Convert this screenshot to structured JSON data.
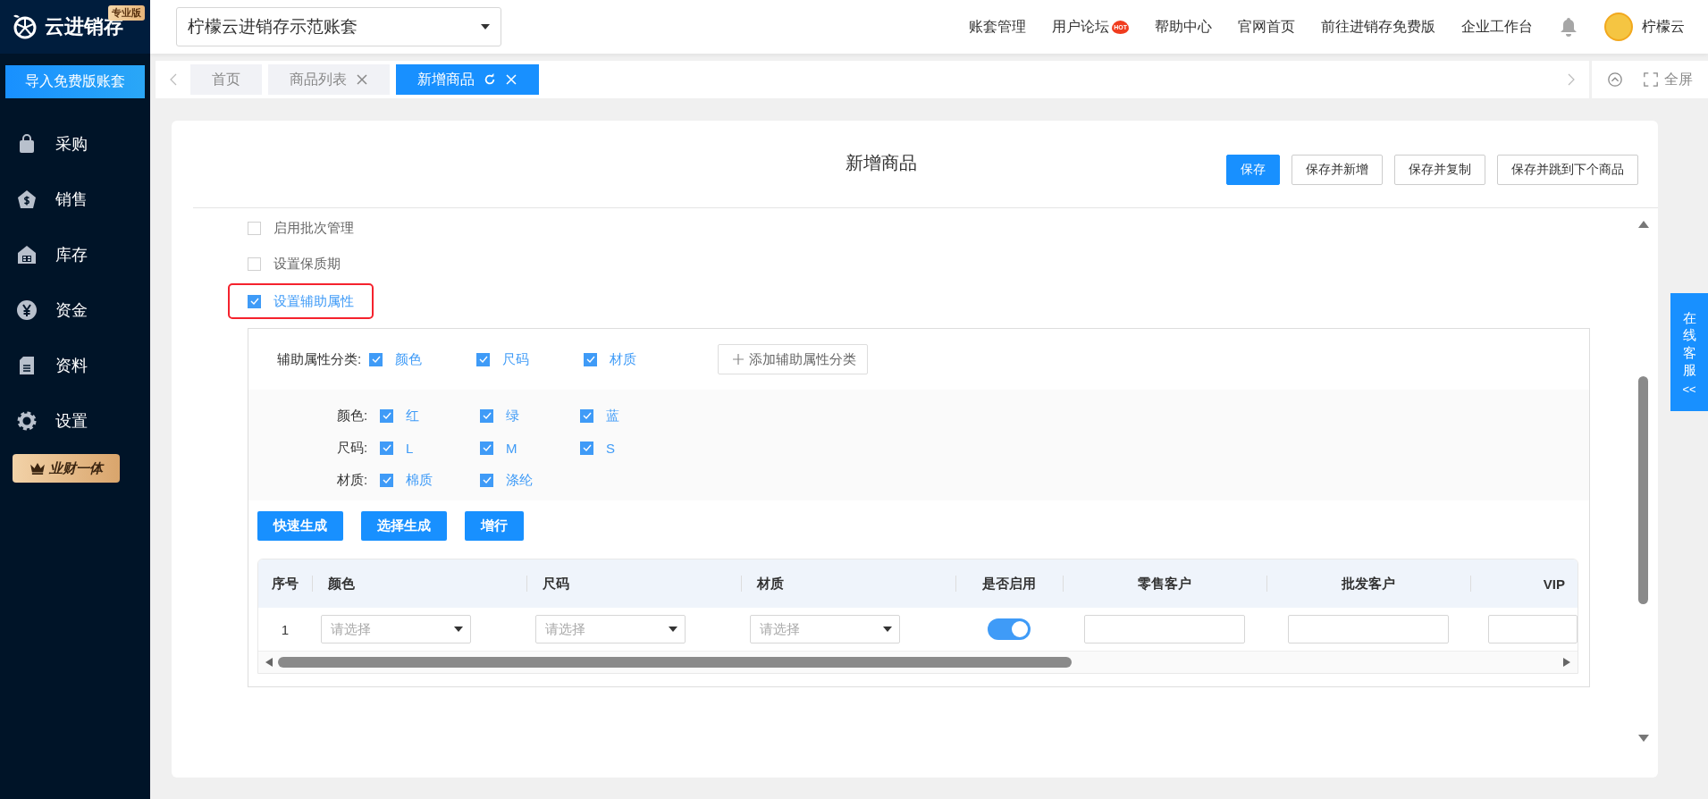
{
  "sidebar": {
    "logo": "云进销存",
    "edition_badge": "专业版",
    "import_button": "导入免费版账套",
    "items": [
      {
        "label": "采购",
        "selected": false
      },
      {
        "label": "销售",
        "selected": false
      },
      {
        "label": "库存",
        "selected": false
      },
      {
        "label": "资金",
        "selected": false
      },
      {
        "label": "资料",
        "selected": false
      },
      {
        "label": "设置",
        "selected": false
      }
    ],
    "promo_badge": "业财一体"
  },
  "topbar": {
    "account_select": "柠檬云进销存示范账套",
    "links": [
      {
        "label": "账套管理"
      },
      {
        "label": "用户论坛",
        "hot_badge": "HOT"
      },
      {
        "label": "帮助中心"
      },
      {
        "label": "官网首页"
      },
      {
        "label": "前往进销存免费版"
      },
      {
        "label": "企业工作台"
      }
    ],
    "user_name": "柠檬云"
  },
  "tabs": [
    {
      "label": "首页",
      "selected": false,
      "closable": false,
      "refreshable": false
    },
    {
      "label": "商品列表",
      "selected": false,
      "closable": true,
      "refreshable": false
    },
    {
      "label": "新增商品",
      "selected": true,
      "closable": true,
      "refreshable": true
    }
  ],
  "fullscreen": "全屏",
  "page": {
    "title": "新增商品",
    "buttons": [
      {
        "label": "保存",
        "primary": true
      },
      {
        "label": "保存并新增",
        "primary": false
      },
      {
        "label": "保存并复制",
        "primary": false
      },
      {
        "label": "保存并跳到下个商品",
        "primary": false
      }
    ]
  },
  "options": [
    {
      "label": "启用批次管理",
      "checked": false,
      "highlighted": false
    },
    {
      "label": "设置保质期",
      "checked": false,
      "highlighted": false
    },
    {
      "label": "设置辅助属性",
      "checked": true,
      "highlighted": true
    }
  ],
  "attributes": {
    "label": "辅助属性分类:",
    "categories": [
      {
        "label": "颜色",
        "checked": true
      },
      {
        "label": "尺码",
        "checked": true
      },
      {
        "label": "材质",
        "checked": true
      }
    ],
    "add_button": "添加辅助属性分类",
    "groups": [
      {
        "label": "颜色:",
        "values": [
          {
            "label": "红",
            "checked": true
          },
          {
            "label": "绿",
            "checked": true
          },
          {
            "label": "蓝",
            "checked": true
          }
        ]
      },
      {
        "label": "尺码:",
        "values": [
          {
            "label": "L",
            "checked": true
          },
          {
            "label": "M",
            "checked": true
          },
          {
            "label": "S",
            "checked": true
          }
        ]
      },
      {
        "label": "材质:",
        "values": [
          {
            "label": "棉质",
            "checked": true
          },
          {
            "label": "涤纶",
            "checked": true
          }
        ]
      }
    ]
  },
  "actions": [
    "快速生成",
    "选择生成",
    "增行"
  ],
  "table": {
    "columns": [
      "序号",
      "颜色",
      "尺码",
      "材质",
      "是否启用",
      "零售客户",
      "批发客户",
      "VIP"
    ],
    "rows": [
      {
        "index": "1",
        "selects": [
          "请选择",
          "请选择",
          "请选择"
        ],
        "enabled": true
      }
    ]
  },
  "chat_tab": {
    "label": "在线客服",
    "collapse": "<<"
  }
}
